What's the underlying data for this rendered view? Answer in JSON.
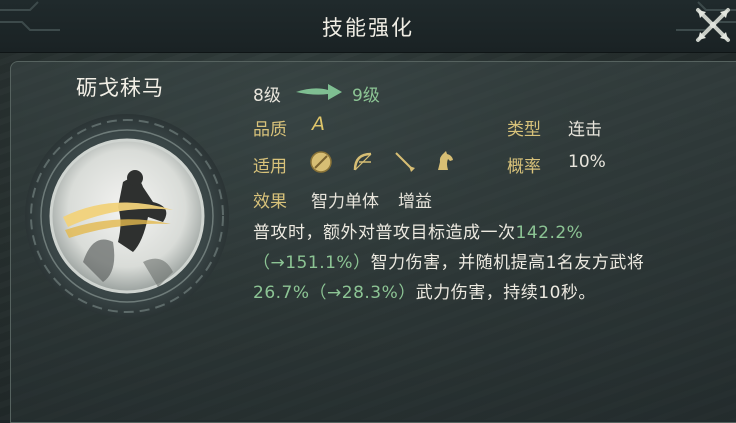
{
  "window": {
    "title": "技能强化"
  },
  "skill": {
    "name": "砺戈秣马",
    "level_current": "8级",
    "level_next": "9级",
    "quality_label": "品质",
    "quality_value": "A",
    "type_label": "类型",
    "type_value": "连击",
    "applicable_label": "适用",
    "applicable_icons": [
      "shield-icon",
      "bow-icon",
      "spear-icon",
      "horse-icon"
    ],
    "probability_label": "概率",
    "probability_value": "10%",
    "effect_label": "效果",
    "effect_tags": [
      "智力单体",
      "增益"
    ]
  },
  "description": {
    "line1_prefix": "普攻时，额外对普攻目标造成一次",
    "line1_value": "142.2%",
    "line2_value": "（→151.1%）",
    "line2_suffix": "智力伤害，并随机提高1名友方武将",
    "line3_value": "26.7%（→28.3%）",
    "line3_suffix": "武力伤害，持续10秒。"
  },
  "colors": {
    "highlight_green": "#8cc494",
    "label_gold": "#d8c27a",
    "text": "#ece9e0"
  }
}
